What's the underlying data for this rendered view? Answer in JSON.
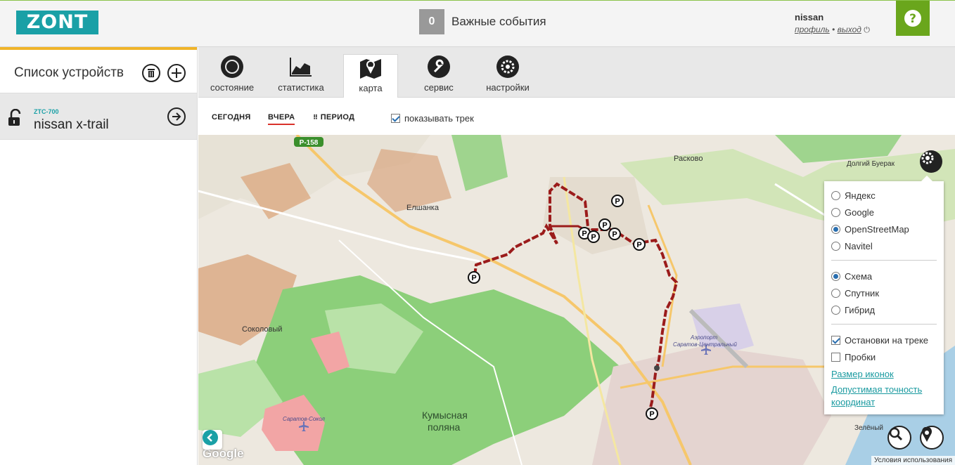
{
  "header": {
    "logo": "ZONT",
    "events_count": "0",
    "events_label": "Важные события",
    "user_name": "nissan",
    "profile_link": "профиль",
    "separator": "•",
    "logout_link": "выход",
    "help_label": "?"
  },
  "sidebar": {
    "title": "Список устройств",
    "devices": [
      {
        "code": "ZTC-700",
        "name": "nissan x-trail"
      }
    ]
  },
  "tabs": [
    {
      "label": "состояние",
      "icon": "circle-icon"
    },
    {
      "label": "статистика",
      "icon": "chart-icon"
    },
    {
      "label": "карта",
      "icon": "map-icon"
    },
    {
      "label": "сервис",
      "icon": "wrench-icon"
    },
    {
      "label": "настройки",
      "icon": "gear-icon"
    }
  ],
  "subtabs": {
    "today": "СЕГОДНЯ",
    "yesterday": "ВЧЕРА",
    "period": "ПЕРИОД",
    "show_track": "показывать трек"
  },
  "map": {
    "places": {
      "elshanka": "Елшанка",
      "sokolovy": "Соколовый",
      "raskovo": "Расково",
      "dolgiy_buerak": "Долгий Буерак",
      "kumysnaya_1": "Кумысная",
      "kumysnaya_2": "поляна",
      "airport_1": "Аэропорт",
      "airport_2": "Саратов-Центральный",
      "saratov_sokol": "Саратов-Сокол",
      "zeleny": "Зелёный",
      "road": "P-158",
      "parking": "P"
    },
    "google": "Google",
    "terms": "Условия использования"
  },
  "layers": {
    "providers": [
      "Яндекс",
      "Google",
      "OpenStreetMap",
      "Navitel"
    ],
    "selected_provider": "OpenStreetMap",
    "types": [
      "Схема",
      "Спутник",
      "Гибрид"
    ],
    "selected_type": "Схема",
    "stops_on_track": "Остановки на треке",
    "traffic": "Пробки",
    "icon_size": "Размер иконок",
    "accuracy": "Допустимая точность координат"
  },
  "colors": {
    "brand": "#1aa0a6",
    "help": "#6aa61c",
    "track": "#9b1b1b",
    "forest": "#8ccf7a"
  }
}
